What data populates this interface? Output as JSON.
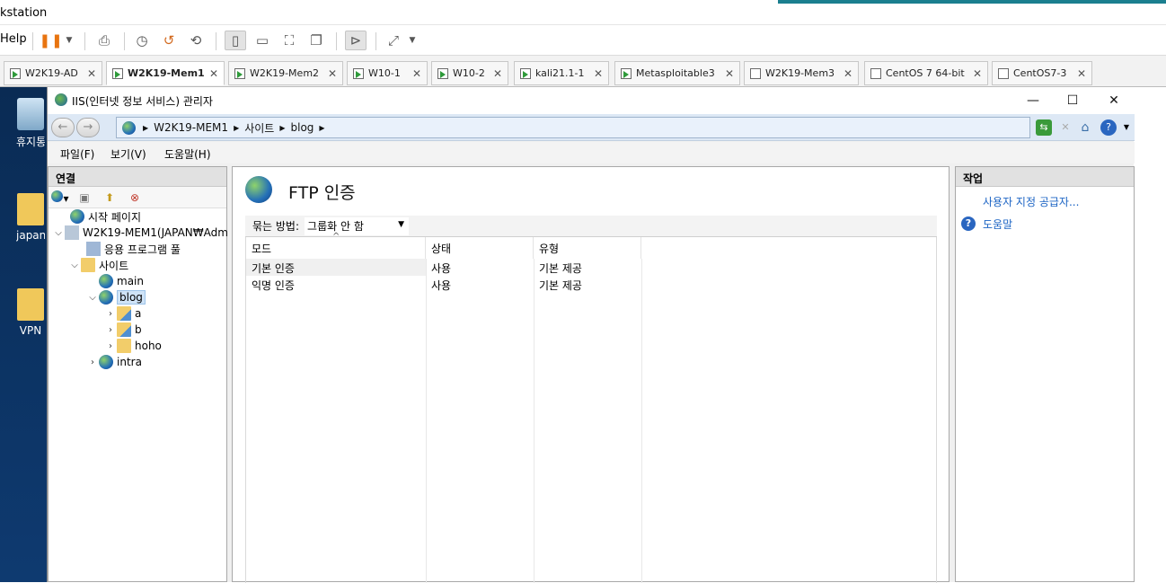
{
  "vmware": {
    "title_fragment": "kstation",
    "help_menu": "Help",
    "tabs": [
      {
        "label": "W2K19-AD",
        "active": false,
        "running": true
      },
      {
        "label": "W2K19-Mem1",
        "active": true,
        "running": true
      },
      {
        "label": "W2K19-Mem2",
        "active": false,
        "running": true
      },
      {
        "label": "W10-1",
        "active": false,
        "running": true
      },
      {
        "label": "W10-2",
        "active": false,
        "running": true
      },
      {
        "label": "kali21.1-1",
        "active": false,
        "running": true
      },
      {
        "label": "Metasploitable3",
        "active": false,
        "running": true
      },
      {
        "label": "W2K19-Mem3",
        "active": false,
        "running": false
      },
      {
        "label": "CentOS 7 64-bit",
        "active": false,
        "running": false
      },
      {
        "label": "CentOS7-3",
        "active": false,
        "running": false
      }
    ],
    "tab_close": "✕"
  },
  "desktop": {
    "icons": [
      {
        "label": "휴지통",
        "type": "recycle-bin"
      },
      {
        "label": "japan",
        "type": "folder"
      },
      {
        "label": "VPN",
        "type": "folder"
      }
    ]
  },
  "iis": {
    "window_title": "IIS(인터넷 정보 서비스) 관리자",
    "window_controls": {
      "minimize": "—",
      "maximize": "☐",
      "close": "✕"
    },
    "breadcrumb": [
      "W2K19-MEM1",
      "사이트",
      "blog"
    ],
    "menu": [
      "파일(F)",
      "보기(V)",
      "도움말(H)"
    ],
    "connections": {
      "title": "연결",
      "tree": [
        {
          "label": "시작 페이지",
          "level": 0,
          "expander": "",
          "icon": "start-page"
        },
        {
          "label": "W2K19-MEM1(JAPAN₩Adm",
          "level": 0,
          "expander": "⌵",
          "icon": "server"
        },
        {
          "label": "응용 프로그램 풀",
          "level": 1,
          "expander": "",
          "icon": "app-pool"
        },
        {
          "label": "사이트",
          "level": 1,
          "expander": "⌵",
          "icon": "sites-folder"
        },
        {
          "label": "main",
          "level": 2,
          "expander": "",
          "icon": "globe"
        },
        {
          "label": "blog",
          "level": 2,
          "expander": "⌵",
          "icon": "globe",
          "selected": true
        },
        {
          "label": "a",
          "level": 3,
          "expander": "›",
          "icon": "virtual-dir"
        },
        {
          "label": "b",
          "level": 3,
          "expander": "›",
          "icon": "virtual-dir"
        },
        {
          "label": "hoho",
          "level": 3,
          "expander": "›",
          "icon": "folder"
        },
        {
          "label": "intra",
          "level": 2,
          "expander": "›",
          "icon": "globe"
        }
      ]
    },
    "feature": {
      "title": "FTP 인증",
      "group_by_label": "묶는 방법:",
      "group_by_value": "그룹화 안 함",
      "columns": [
        "모드",
        "상태",
        "유형"
      ],
      "rows": [
        [
          "기본 인증",
          "사용",
          "기본 제공"
        ],
        [
          "익명 인증",
          "사용",
          "기본 제공"
        ]
      ]
    },
    "actions": {
      "title": "작업",
      "items": [
        {
          "label": "사용자 지정 공급자...",
          "icon": ""
        },
        {
          "label": "도움말",
          "icon": "help"
        }
      ]
    }
  }
}
